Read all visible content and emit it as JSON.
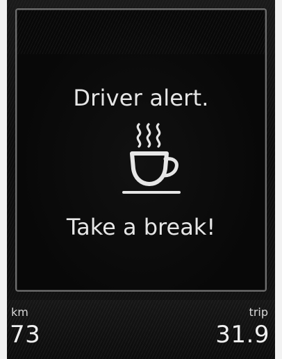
{
  "alert": {
    "title": "Driver alert.",
    "message": "Take a break!",
    "icon": "coffee-cup-icon"
  },
  "status": {
    "distance_label": "km",
    "distance_value": "73",
    "trip_label": "trip",
    "trip_value": "31.9"
  },
  "colors": {
    "text": "#e6e6e6",
    "panel_border": "#6f6f6f",
    "background": "#0a0a0a"
  }
}
